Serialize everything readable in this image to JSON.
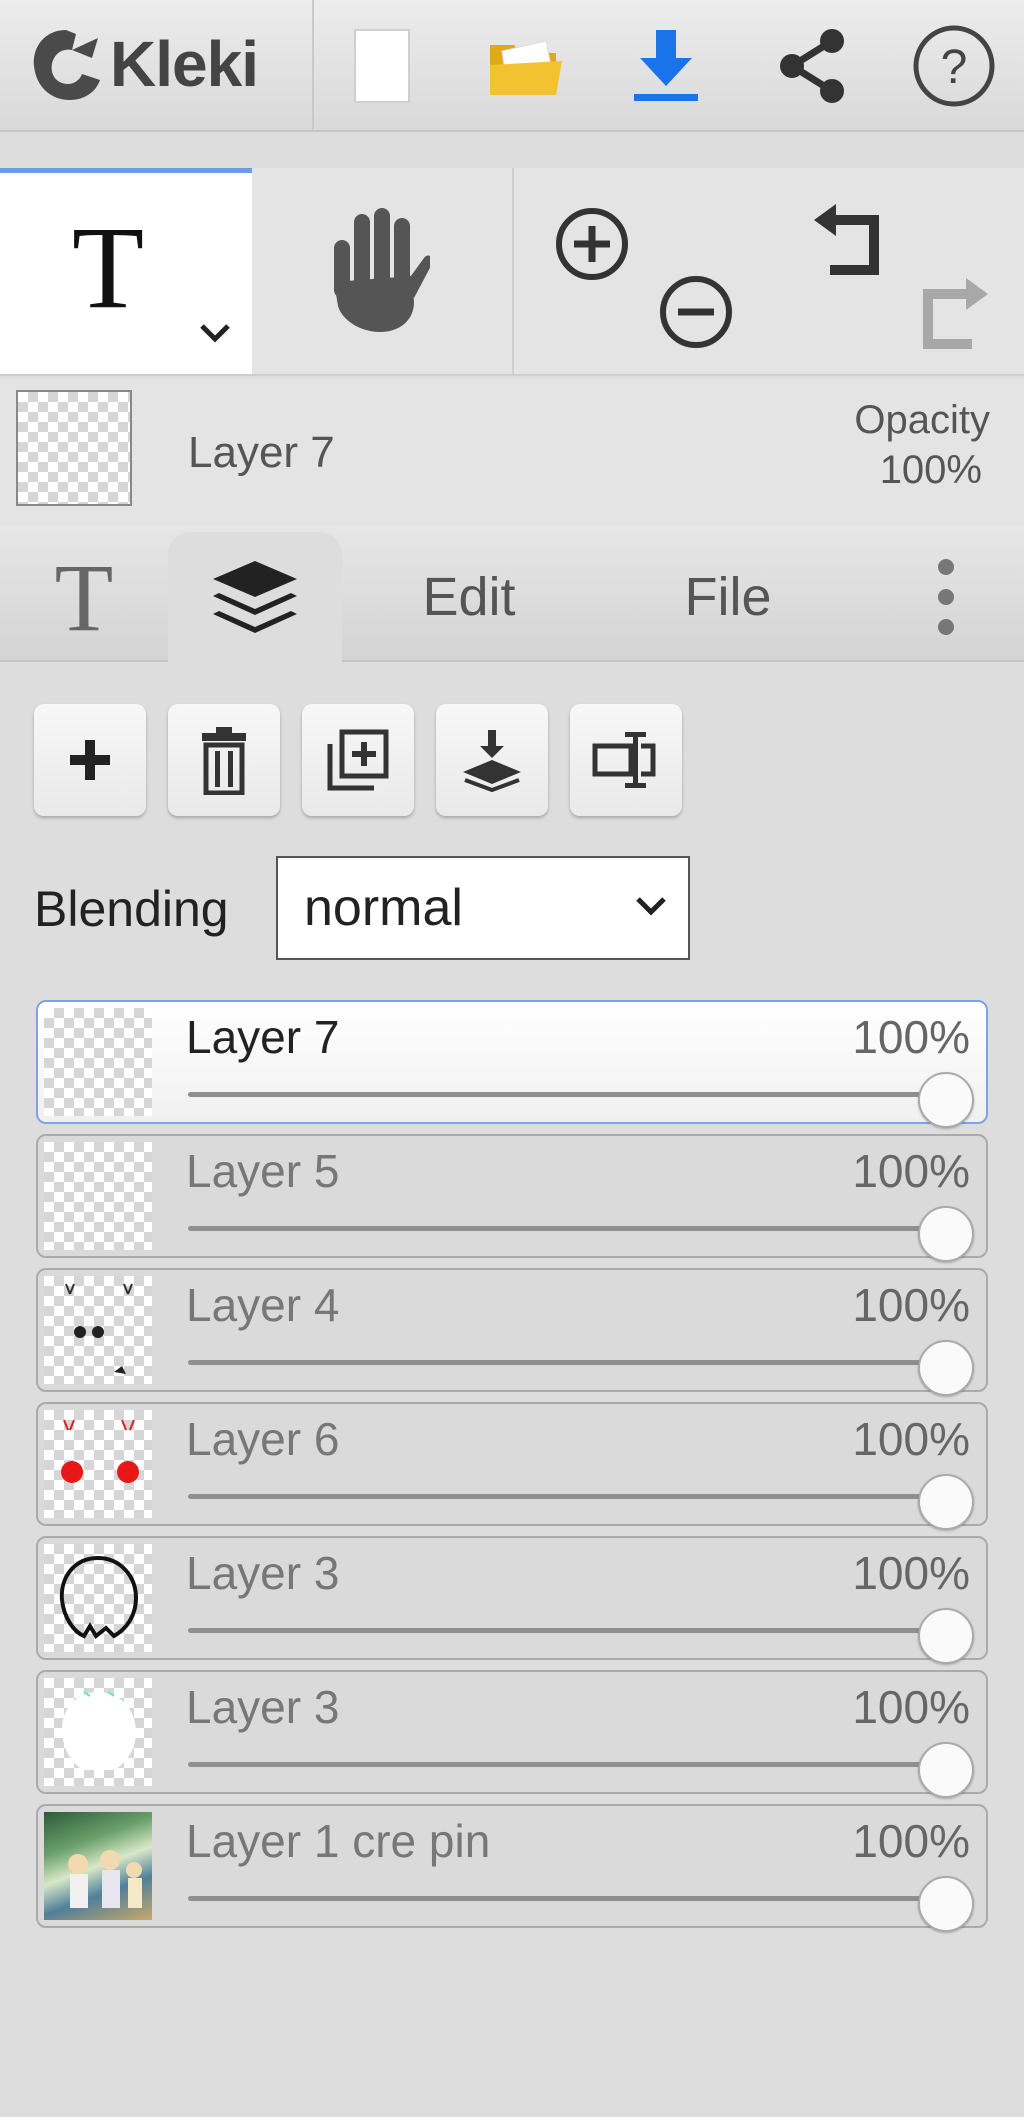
{
  "app": {
    "brand": "Kleki"
  },
  "topbar": {
    "icons": [
      "kleki-logo-icon",
      "new-file-icon",
      "open-folder-icon",
      "download-icon",
      "share-icon",
      "help-icon"
    ],
    "accent": "#1a73e8",
    "folder_color": "#f2c230"
  },
  "tools": {
    "active_glyph": "T",
    "active_tool": "text-tool",
    "others": [
      "hand-tool",
      "zoom-in",
      "zoom-out",
      "undo",
      "redo"
    ]
  },
  "current_layer": {
    "name": "Layer 7",
    "opacity_label": "Opacity",
    "opacity_value": "100%"
  },
  "tabs": {
    "text_glyph": "T",
    "items": [
      "Edit",
      "File"
    ]
  },
  "layer_panel": {
    "actions": [
      "add-layer",
      "delete-layer",
      "duplicate-layer",
      "merge-down",
      "rename-layer"
    ],
    "blending_label": "Blending",
    "blending_value": "normal",
    "layers": [
      {
        "name": "Layer 7",
        "opacity": "100%",
        "opacity_fraction": 1.0,
        "selected": true
      },
      {
        "name": "Layer 5",
        "opacity": "100%",
        "opacity_fraction": 1.0,
        "selected": false
      },
      {
        "name": "Layer 4",
        "opacity": "100%",
        "opacity_fraction": 1.0,
        "selected": false
      },
      {
        "name": "Layer 6",
        "opacity": "100%",
        "opacity_fraction": 1.0,
        "selected": false
      },
      {
        "name": "Layer 3",
        "opacity": "100%",
        "opacity_fraction": 1.0,
        "selected": false
      },
      {
        "name": "Layer 3",
        "opacity": "100%",
        "opacity_fraction": 1.0,
        "selected": false
      },
      {
        "name": "Layer 1 cre pin",
        "opacity": "100%",
        "opacity_fraction": 1.0,
        "selected": false
      }
    ]
  }
}
